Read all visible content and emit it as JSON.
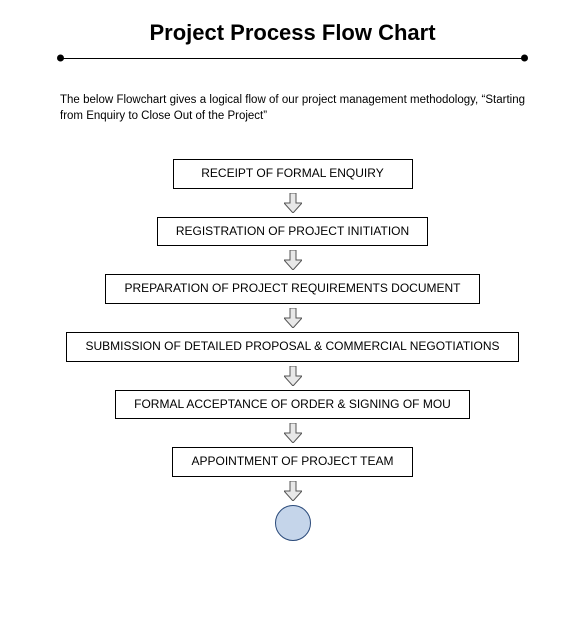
{
  "title": "Project Process Flow Chart",
  "description": "The below Flowchart gives a logical flow of our project management methodology, “Starting from Enquiry to Close Out of the Project”",
  "steps": {
    "s0": "RECEIPT OF FORMAL ENQUIRY",
    "s1": "REGISTRATION OF PROJECT INITIATION",
    "s2": "PREPARATION OF PROJECT REQUIREMENTS DOCUMENT",
    "s3": "SUBMISSION OF DETAILED PROPOSAL & COMMERCIAL NEGOTIATIONS",
    "s4": "FORMAL ACCEPTANCE OF ORDER & SIGNING OF MOU",
    "s5": "APPOINTMENT OF PROJECT TEAM"
  }
}
